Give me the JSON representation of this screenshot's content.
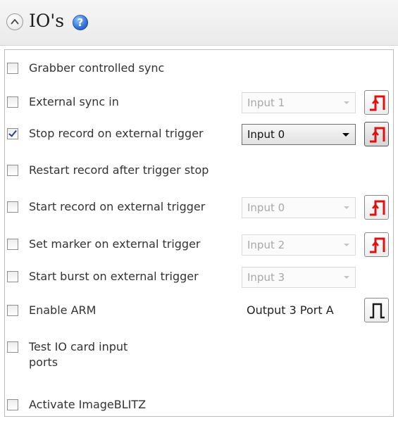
{
  "header": {
    "title": "IO's",
    "help": "?"
  },
  "rows": [
    {
      "label": "Grabber controlled sync",
      "checked": false
    },
    {
      "label": "External sync in",
      "checked": false,
      "combo": "Input 1",
      "combo_enabled": false
    },
    {
      "label": "Stop record on external trigger",
      "checked": true,
      "combo": "Input 0",
      "combo_enabled": true
    },
    {
      "label": "Restart record after trigger stop",
      "checked": false
    },
    {
      "label": "Start record on external trigger",
      "checked": false,
      "combo": "Input 0",
      "combo_enabled": false
    },
    {
      "label": "Set marker on external trigger",
      "checked": false,
      "combo": "Input 2",
      "combo_enabled": false
    },
    {
      "label": "Start burst on external trigger",
      "checked": false,
      "combo": "Input 3",
      "combo_enabled": false
    },
    {
      "label": "Enable ARM",
      "checked": false,
      "output": "Output 3 Port A"
    },
    {
      "label": "Test IO card input ports",
      "checked": false
    },
    {
      "label": "Activate ImageBLITZ",
      "checked": false
    }
  ],
  "colors": {
    "edge_red": "#e01010",
    "pulse_black": "#1a1a1a",
    "help_blue": "#2d6fd6"
  }
}
